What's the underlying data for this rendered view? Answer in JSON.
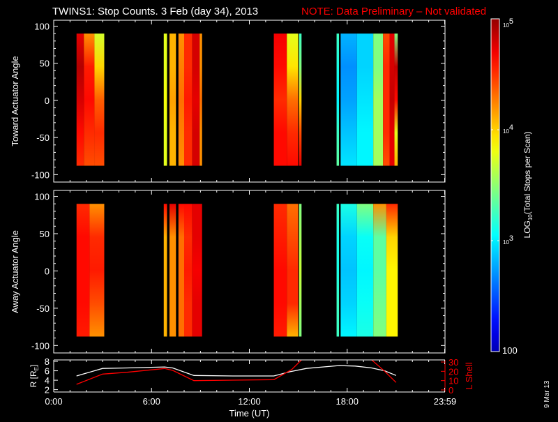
{
  "title": {
    "main": "TWINS1: Stop Counts.  3 Feb (day  34), 2013",
    "note": "NOTE: Data Preliminary – Not validated"
  },
  "date_stamp": "9 Mar 13",
  "colors": {
    "background": "#000000",
    "axes": "#ffffff",
    "lshell": "#ff0000",
    "radius": "#ffffff"
  },
  "chart_data": [
    {
      "type": "heatmap",
      "id": "toward",
      "ylabel": "Toward Actuator Angle",
      "ylim": [
        -110,
        108
      ],
      "yticks": [
        100,
        50,
        0,
        -50,
        -100
      ],
      "ytick_labels": [
        "100",
        "50",
        "0",
        "-50",
        "-100"
      ],
      "xlim": [
        0,
        24
      ],
      "angle_samples": [
        90,
        45,
        0,
        -45,
        -88
      ],
      "columns": [
        {
          "start": 1.4,
          "end": 1.85,
          "log_counts": [
            4.7,
            4.85,
            4.75,
            4.6,
            4.5
          ]
        },
        {
          "start": 1.85,
          "end": 2.5,
          "log_counts": [
            4.2,
            4.55,
            4.6,
            4.5,
            4.4
          ]
        },
        {
          "start": 2.5,
          "end": 3.1,
          "log_counts": [
            3.75,
            4.0,
            4.35,
            4.5,
            4.4
          ]
        },
        {
          "start": 6.75,
          "end": 6.95,
          "log_counts": [
            3.8,
            3.8,
            3.85,
            3.8,
            3.8
          ]
        },
        {
          "start": 7.1,
          "end": 7.5,
          "log_counts": [
            4.1,
            4.1,
            4.15,
            4.1,
            4.1
          ]
        },
        {
          "start": 7.65,
          "end": 8.0,
          "log_counts": [
            4.2,
            4.25,
            4.3,
            4.25,
            4.2
          ]
        },
        {
          "start": 8.0,
          "end": 8.5,
          "log_counts": [
            4.5,
            4.5,
            4.55,
            4.5,
            4.5
          ]
        },
        {
          "start": 8.5,
          "end": 8.95,
          "log_counts": [
            4.75,
            4.75,
            4.7,
            4.75,
            4.75
          ]
        },
        {
          "start": 8.95,
          "end": 9.1,
          "log_counts": [
            4.2,
            4.2,
            4.3,
            4.2,
            4.2
          ]
        },
        {
          "start": 13.5,
          "end": 14.3,
          "log_counts": [
            4.65,
            4.6,
            4.5,
            4.6,
            4.6
          ]
        },
        {
          "start": 14.3,
          "end": 15.0,
          "log_counts": [
            3.8,
            3.95,
            4.3,
            4.5,
            4.6
          ]
        },
        {
          "start": 15.05,
          "end": 15.2,
          "log_counts": [
            3.3,
            3.5,
            4.0,
            4.4,
            4.7
          ]
        },
        {
          "start": 17.35,
          "end": 17.5,
          "log_counts": [
            3.3,
            3.2,
            3.1,
            3.3,
            3.4
          ]
        },
        {
          "start": 17.6,
          "end": 18.6,
          "log_counts": [
            2.9,
            2.8,
            2.85,
            2.95,
            3.05
          ]
        },
        {
          "start": 18.6,
          "end": 19.6,
          "log_counts": [
            3.0,
            3.0,
            3.05,
            3.1,
            3.1
          ]
        },
        {
          "start": 19.6,
          "end": 20.2,
          "log_counts": [
            3.5,
            3.5,
            3.6,
            3.6,
            3.6
          ]
        },
        {
          "start": 20.2,
          "end": 20.6,
          "log_counts": [
            4.4,
            4.5,
            4.5,
            4.5,
            4.4
          ]
        },
        {
          "start": 20.6,
          "end": 20.9,
          "log_counts": [
            4.7,
            4.75,
            4.8,
            4.7,
            4.7
          ]
        },
        {
          "start": 20.9,
          "end": 21.1,
          "log_counts": [
            3.5,
            4.8,
            4.6,
            3.8,
            4.1
          ]
        }
      ]
    },
    {
      "type": "heatmap",
      "id": "away",
      "ylabel": "Away Actuator Angle",
      "ylim": [
        -110,
        108
      ],
      "yticks": [
        100,
        50,
        0,
        -50,
        -100
      ],
      "ytick_labels": [
        "100",
        "50",
        "0",
        "-50",
        "-100"
      ],
      "xlim": [
        0,
        24
      ],
      "angle_samples": [
        90,
        45,
        0,
        -45,
        -88
      ],
      "columns": [
        {
          "start": 1.4,
          "end": 2.2,
          "log_counts": [
            4.5,
            4.6,
            4.6,
            4.6,
            4.55
          ]
        },
        {
          "start": 2.2,
          "end": 3.1,
          "log_counts": [
            4.2,
            4.5,
            4.55,
            4.4,
            4.2
          ]
        },
        {
          "start": 6.75,
          "end": 6.95,
          "log_counts": [
            4.6,
            4.1,
            4.1,
            4.1,
            4.1
          ]
        },
        {
          "start": 7.1,
          "end": 7.5,
          "log_counts": [
            4.7,
            4.2,
            4.2,
            4.2,
            4.2
          ]
        },
        {
          "start": 7.65,
          "end": 8.0,
          "log_counts": [
            4.6,
            4.3,
            4.3,
            4.3,
            4.3
          ]
        },
        {
          "start": 8.0,
          "end": 8.5,
          "log_counts": [
            4.6,
            4.5,
            4.55,
            4.5,
            4.5
          ]
        },
        {
          "start": 8.5,
          "end": 9.1,
          "log_counts": [
            4.7,
            4.7,
            4.65,
            4.7,
            4.7
          ]
        },
        {
          "start": 13.5,
          "end": 14.3,
          "log_counts": [
            4.5,
            4.55,
            4.6,
            4.6,
            4.55
          ]
        },
        {
          "start": 14.3,
          "end": 15.0,
          "log_counts": [
            4.3,
            4.4,
            4.5,
            4.5,
            4.1
          ]
        },
        {
          "start": 15.05,
          "end": 15.2,
          "log_counts": [
            3.5,
            3.6,
            3.7,
            3.6,
            3.5
          ]
        },
        {
          "start": 17.35,
          "end": 17.5,
          "log_counts": [
            3.3,
            3.2,
            3.2,
            3.3,
            3.3
          ]
        },
        {
          "start": 17.6,
          "end": 18.6,
          "log_counts": [
            3.2,
            3.0,
            2.95,
            3.0,
            3.1
          ]
        },
        {
          "start": 18.6,
          "end": 19.6,
          "log_counts": [
            3.5,
            3.15,
            3.1,
            3.15,
            3.2
          ]
        },
        {
          "start": 19.6,
          "end": 20.4,
          "log_counts": [
            4.2,
            3.4,
            3.4,
            3.45,
            3.5
          ]
        },
        {
          "start": 20.4,
          "end": 21.1,
          "log_counts": [
            4.5,
            4.0,
            3.9,
            3.9,
            3.9
          ]
        }
      ]
    },
    {
      "type": "line",
      "id": "orbit",
      "xlabel": "Time (UT)",
      "xticks": [
        0,
        6,
        12,
        18,
        24
      ],
      "xtick_labels": [
        "0:00",
        "6:00",
        "12:00",
        "18:00",
        "23:59"
      ],
      "xlim": [
        0,
        24
      ],
      "ylabel_left": "R [R",
      "ylabel_left_sub": "E",
      "ylabel_left_end": "]",
      "ylim_left": [
        1.5,
        8.3
      ],
      "yticks_left": [
        2,
        4,
        6,
        8
      ],
      "ytick_labels_left": [
        "2",
        "4",
        "6",
        "8"
      ],
      "ylabel_right": "L Shell",
      "ylim_right": [
        -2.25,
        32.25
      ],
      "yticks_right": [
        0,
        10,
        20,
        30
      ],
      "ytick_labels_right": [
        "0",
        "10",
        "20",
        "30"
      ],
      "series": [
        {
          "name": "R",
          "axis": "left",
          "x": [
            1.4,
            3.0,
            4.5,
            6.8,
            7.3,
            8.6,
            11.0,
            13.5,
            14.5,
            15.5,
            16.5,
            17.5,
            18.5,
            19.5,
            20.3,
            21.0
          ],
          "y": [
            4.9,
            6.5,
            6.6,
            6.8,
            6.6,
            5.0,
            4.9,
            4.9,
            5.8,
            6.5,
            6.8,
            7.1,
            7.0,
            6.6,
            6.0,
            5.0
          ]
        },
        {
          "name": "L Shell",
          "axis": "right",
          "x": [
            1.4,
            3.0,
            4.5,
            6.8,
            7.3,
            8.6,
            11.0,
            13.5,
            14.6,
            15.2
          ],
          "y": [
            6,
            17,
            19,
            23,
            21,
            10,
            10.5,
            11,
            22,
            32.3
          ]
        },
        {
          "name": "L Shell (late)",
          "axis": "right",
          "x": [
            19.5,
            20.3,
            21.0
          ],
          "y": [
            32.3,
            20,
            8
          ]
        }
      ]
    }
  ],
  "colorbar": {
    "title": "LOG",
    "title_sub": "10",
    "title_rest": "(Total Stops per Scan)",
    "range_log": [
      2,
      5
    ],
    "ticks": [
      {
        "log": 5,
        "base": "10",
        "exp": "5"
      },
      {
        "log": 4,
        "base": "10",
        "exp": "4"
      },
      {
        "log": 3,
        "base": "10",
        "exp": "3"
      }
    ],
    "bottom_label": "100"
  }
}
